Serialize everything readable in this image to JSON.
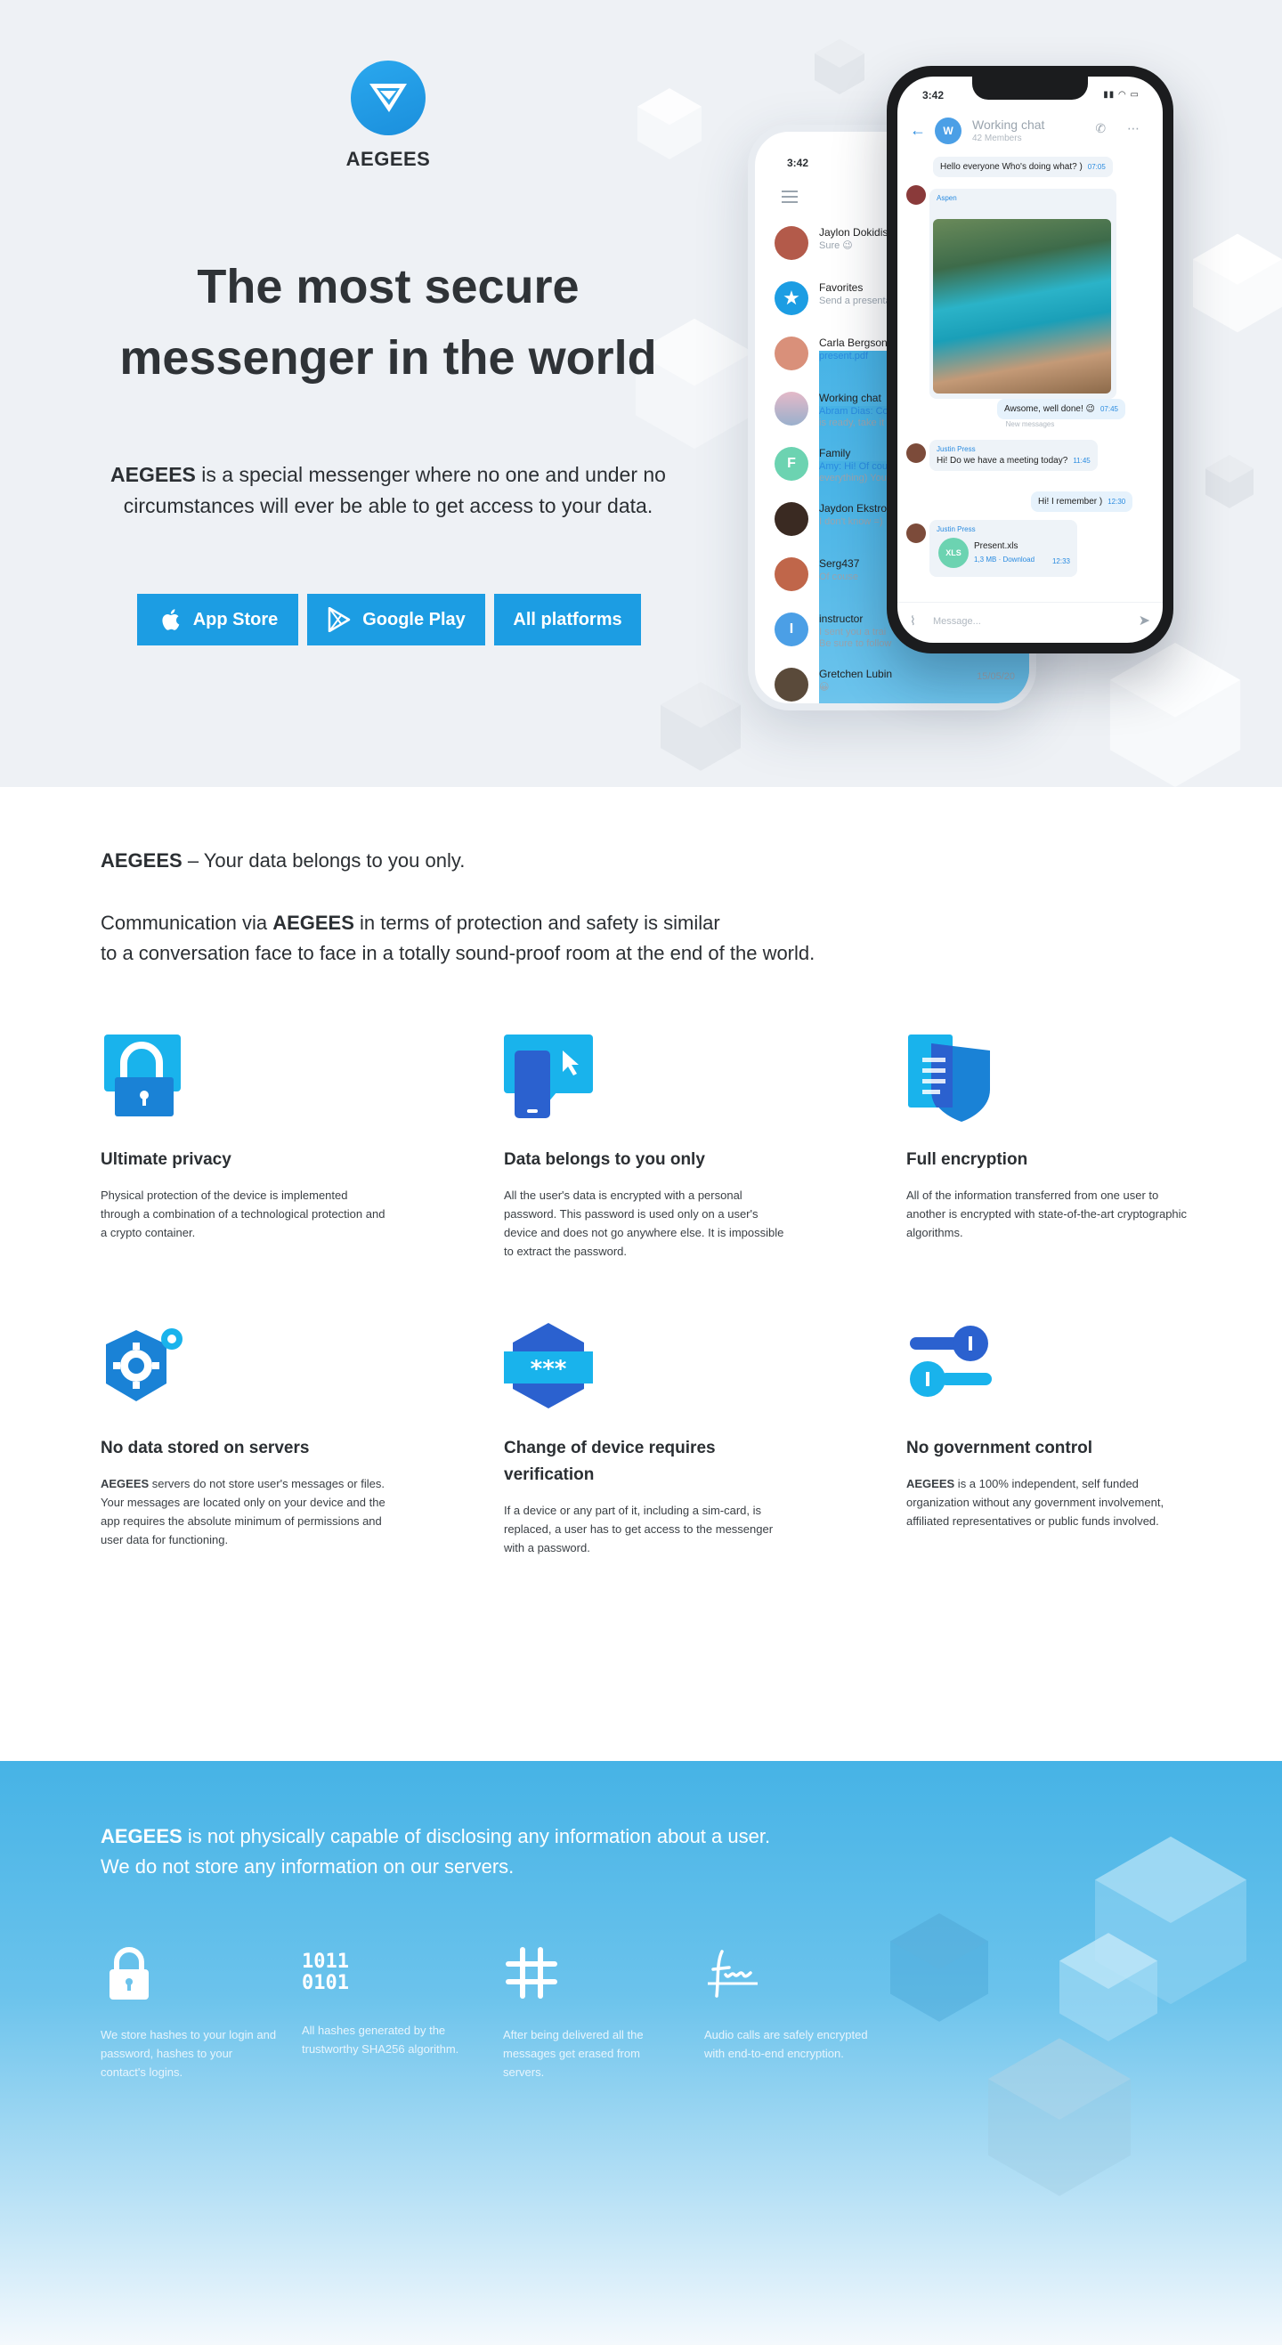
{
  "brand": {
    "name": "AEGEES",
    "accent": "#1c9de3"
  },
  "hero": {
    "title_line1": "The most secure",
    "title_line2": "messenger in the world",
    "desc_brand": "AEGEES",
    "desc_line1": " is a special messenger where no one and under no",
    "desc_line2": "circumstances will ever be able to get access to your data.",
    "buttons": [
      {
        "label": "App Store",
        "icon": "apple-icon"
      },
      {
        "label": "Google Play",
        "icon": "google-play-icon"
      },
      {
        "label": "All platforms",
        "icon": ""
      }
    ]
  },
  "phone_back": {
    "time": "3:42",
    "chats": [
      {
        "name": "Jaylon Dokidis",
        "sub": "Sure 😉",
        "sub_style": "gray",
        "color": "#b35a4a",
        "time": ""
      },
      {
        "name": "Favorites",
        "sub": "Send a presentati",
        "sub_style": "gray",
        "color": "#1c9de3",
        "time": ""
      },
      {
        "name": "Carla Bergson",
        "sub": "present.pdf",
        "sub_style": "blue",
        "color": "#d9907a",
        "time": ""
      },
      {
        "name": "Working chat",
        "sub": "Abram Dias: Co",
        "sub2": "is ready, take it",
        "sub_style": "mixed",
        "color": "#c9a0b5",
        "time": ""
      },
      {
        "name": "Family",
        "sub": "Amy: Hi! Of cou",
        "sub2": "everything) You",
        "sub_style": "mixed",
        "color": "#6cd3b1",
        "letter": "F",
        "time": ""
      },
      {
        "name": "Jaydon Ekstrom",
        "sub": "I don't know =)",
        "sub_style": "gray",
        "color": "#3a2a22",
        "time": ""
      },
      {
        "name": "Serg437",
        "sub": "Of couse",
        "sub_style": "gray",
        "color": "#c0664a",
        "time": ""
      },
      {
        "name": "instructor",
        "sub": "I sent you a trai",
        "sub2": "Be sure to follow",
        "sub_style": "gray",
        "color": "#4b9fe6",
        "letter": "I",
        "time": ""
      },
      {
        "name": "Gretchen Lubin",
        "sub": "😀",
        "sub_style": "gray",
        "color": "#5a4a3a",
        "time": "15/05/20"
      }
    ]
  },
  "phone_front": {
    "time": "3:42",
    "chat_title": "Working chat",
    "members": "42 Members",
    "msg1": "Hello everyone Who's doing what? )",
    "msg1_time": "07:05",
    "sender_aspen": "Aspen",
    "reply1": "Awsome, well done! 😉",
    "reply1_time": "07:45",
    "new_messages": "New messages",
    "sender_justin": "Justin Press",
    "msg2": "Hi! Do we have a meeting today?",
    "msg2_time": "11:45",
    "reply2": "Hi! I remember )",
    "reply2_time": "12:30",
    "file_name": "Present.xls",
    "file_meta": "1,3 MB · Download",
    "file_time": "12:33",
    "file_badge": "XLS",
    "input_placeholder": "Message..."
  },
  "intro": {
    "brand": "AEGEES",
    "line1_rest": " – Your data belongs to you only.",
    "line2_pre": "Communication via ",
    "line2_brand": "AEGEES",
    "line2_post": " in terms of protection and safety is similar",
    "line3": "to a conversation face to face in a totally sound-proof room at the end of the world."
  },
  "features": [
    {
      "title": "Ultimate privacy",
      "text": "Physical protection of the device is implemented through a combination of a technological protection and a crypto container.",
      "icon": "lock-icon"
    },
    {
      "title": "Data belongs to you only",
      "text": "All the user's data is encrypted with a personal password. This password is used only on a user's device and does not go anywhere else. It is impossible to extract the password.",
      "icon": "device-icon"
    },
    {
      "title": "Full encryption",
      "text": "All of the information transferred from one user to another is encrypted with state-of-the-art cryptographic algorithms.",
      "icon": "shield-document-icon"
    },
    {
      "title": "No data stored on servers",
      "text_brand": "AEGEES",
      "text": " servers do not store user's messages or files. Your messages are located only on your device and the app requires the absolute minimum of permissions and user data for functioning.",
      "icon": "gear-icon"
    },
    {
      "title_line1": "Change of device requires",
      "title_line2": "verification",
      "text": "If a device or any part of it, including a sim-card, is replaced, a user has to get access to the messenger with a password.",
      "icon": "password-icon"
    },
    {
      "title": "No government control",
      "text_brand": "AEGEES",
      "text": " is a 100% independent, self funded organization without any government involvement, affiliated representatives or public funds involved.",
      "icon": "keys-icon"
    }
  ],
  "blue": {
    "brand": "AEGEES",
    "line1_rest": " is not physically capable of disclosing any information about a user.",
    "line2": "We do not store any information on our servers.",
    "items": [
      {
        "text": "We store hashes to your login and password, hashes to your contact's logins.",
        "icon": "padlock-icon"
      },
      {
        "text": "All hashes generated by the trustworthy SHA256 algorithm.",
        "icon": "binary-icon",
        "binary1": "1011",
        "binary2": "0101"
      },
      {
        "text": "After being delivered all the messages get erased from servers.",
        "icon": "hash-icon"
      },
      {
        "text": "Audio calls are safely encrypted with end-to-end encryption.",
        "icon": "signature-icon"
      }
    ]
  }
}
